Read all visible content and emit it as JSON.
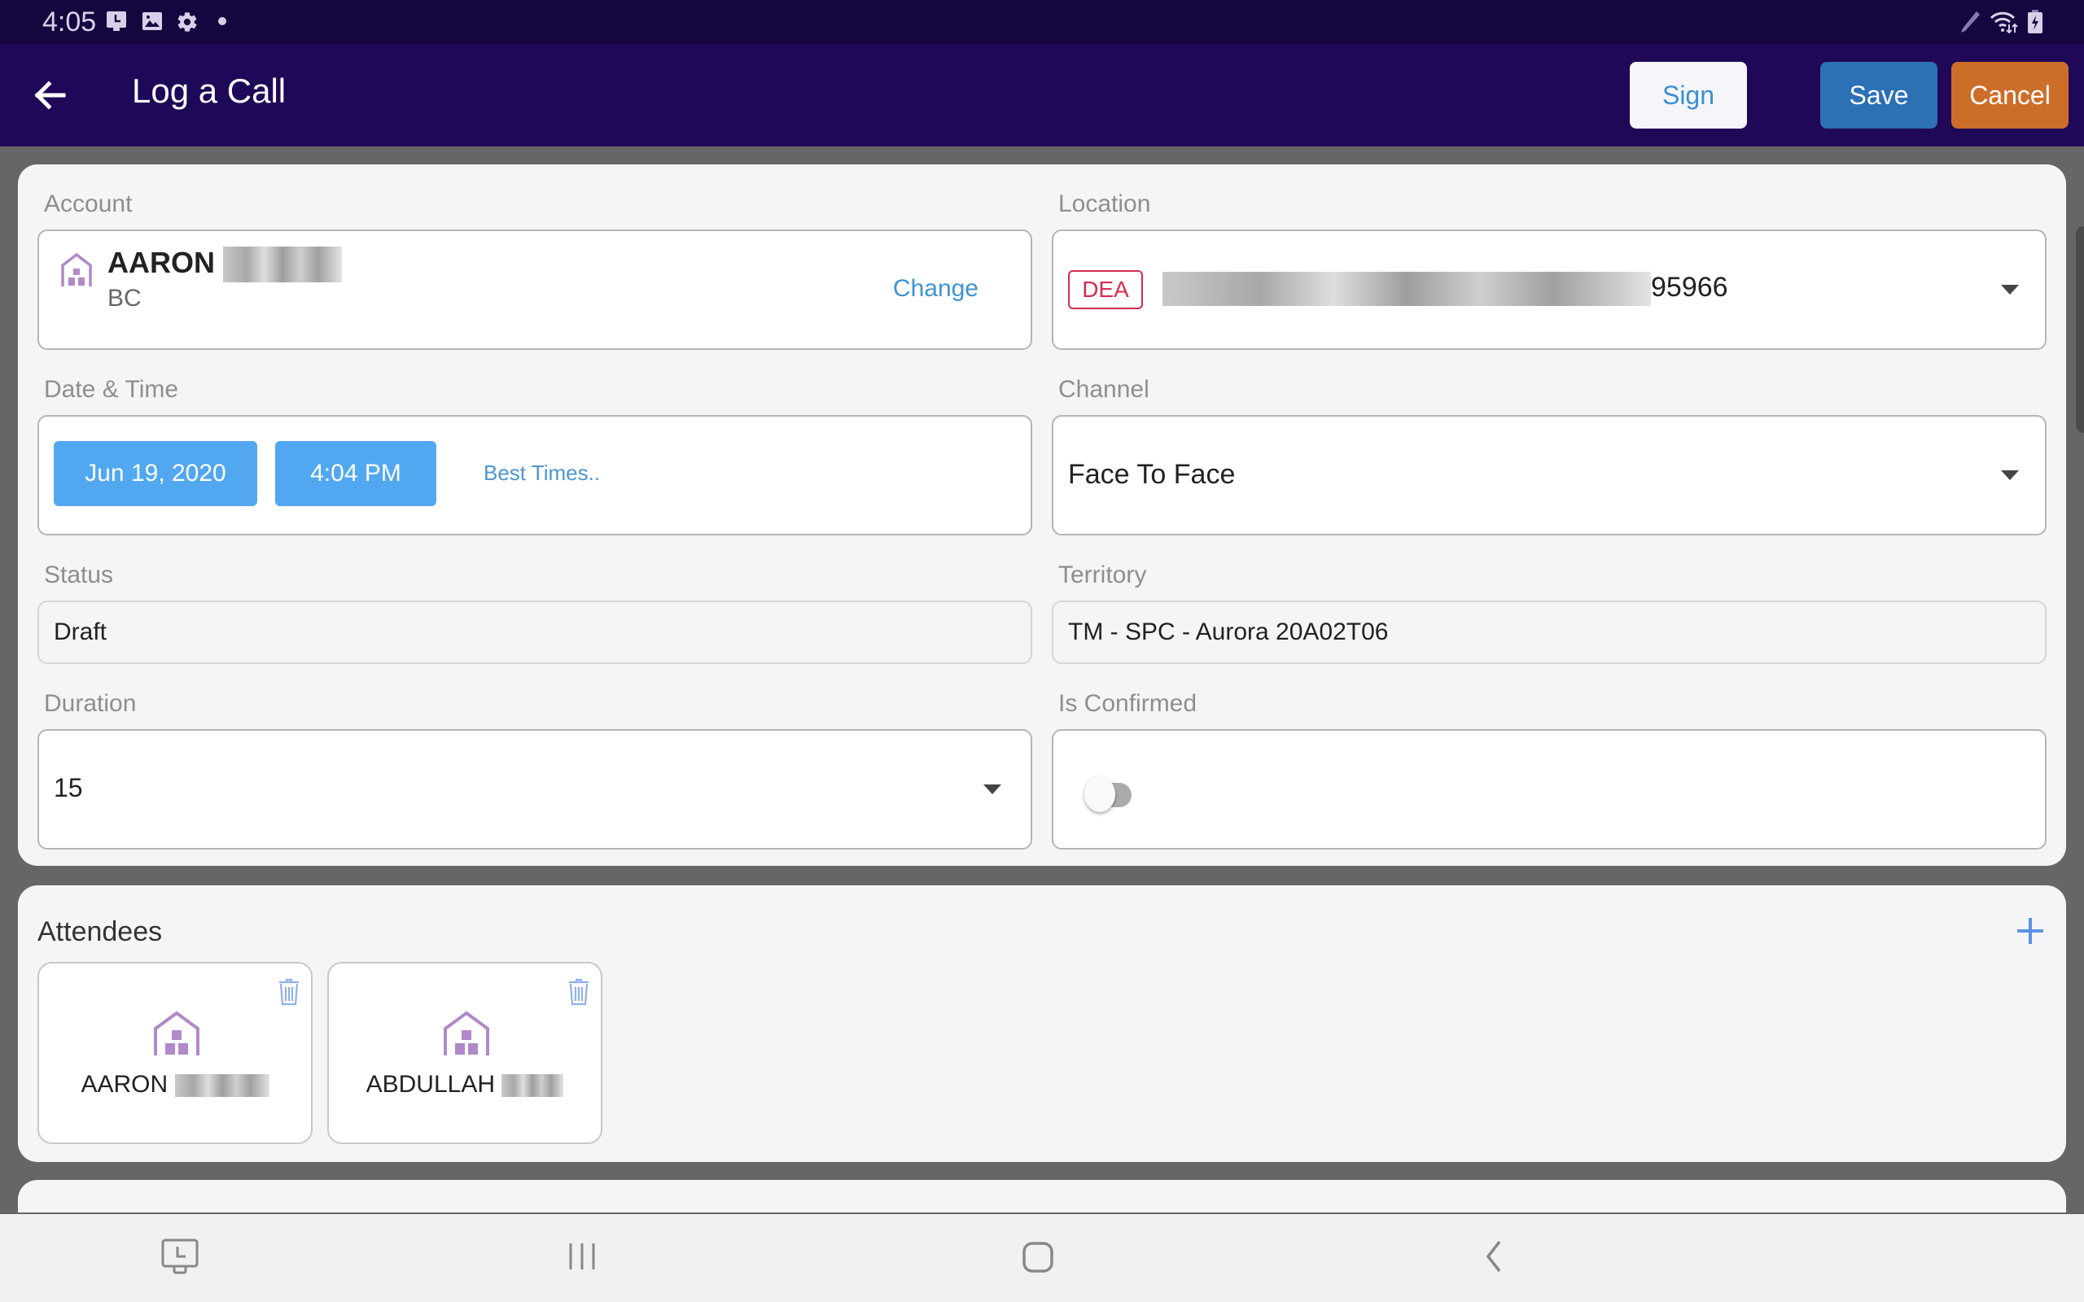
{
  "status_bar": {
    "time": "4:05",
    "left_icons": [
      "screenshot-icon",
      "image-icon",
      "settings-gear-icon",
      "notification-dot-icon"
    ],
    "right_icons": [
      "pen-icon",
      "wifi-data-icon",
      "battery-charging-icon"
    ]
  },
  "app_bar": {
    "title": "Log a Call",
    "sign_label": "Sign",
    "save_label": "Save",
    "cancel_label": "Cancel",
    "colors": {
      "bar": "#1f0857",
      "save": "#2c70b6",
      "cancel": "#cc6e2a",
      "sign_text": "#3a8fd6"
    }
  },
  "form": {
    "account": {
      "label": "Account",
      "name": "AARON",
      "name_redacted": true,
      "subtitle": "BC",
      "change_label": "Change"
    },
    "location": {
      "label": "Location",
      "badge": "DEA",
      "address_redacted": true,
      "address_suffix": "95966"
    },
    "date_time": {
      "label": "Date & Time",
      "date": "Jun 19, 2020",
      "time": "4:04 PM",
      "best_times_label": "Best Times.."
    },
    "channel": {
      "label": "Channel",
      "value": "Face To Face"
    },
    "status": {
      "label": "Status",
      "value": "Draft"
    },
    "territory": {
      "label": "Territory",
      "value": "TM - SPC - Aurora 20A02T06"
    },
    "duration": {
      "label": "Duration",
      "value": "15"
    },
    "is_confirmed": {
      "label": "Is Confirmed",
      "checked": false
    }
  },
  "attendees": {
    "title": "Attendees",
    "items": [
      {
        "name": "AARON",
        "name_redacted": true
      },
      {
        "name": "ABDULLAH",
        "name_redacted": true
      }
    ]
  }
}
